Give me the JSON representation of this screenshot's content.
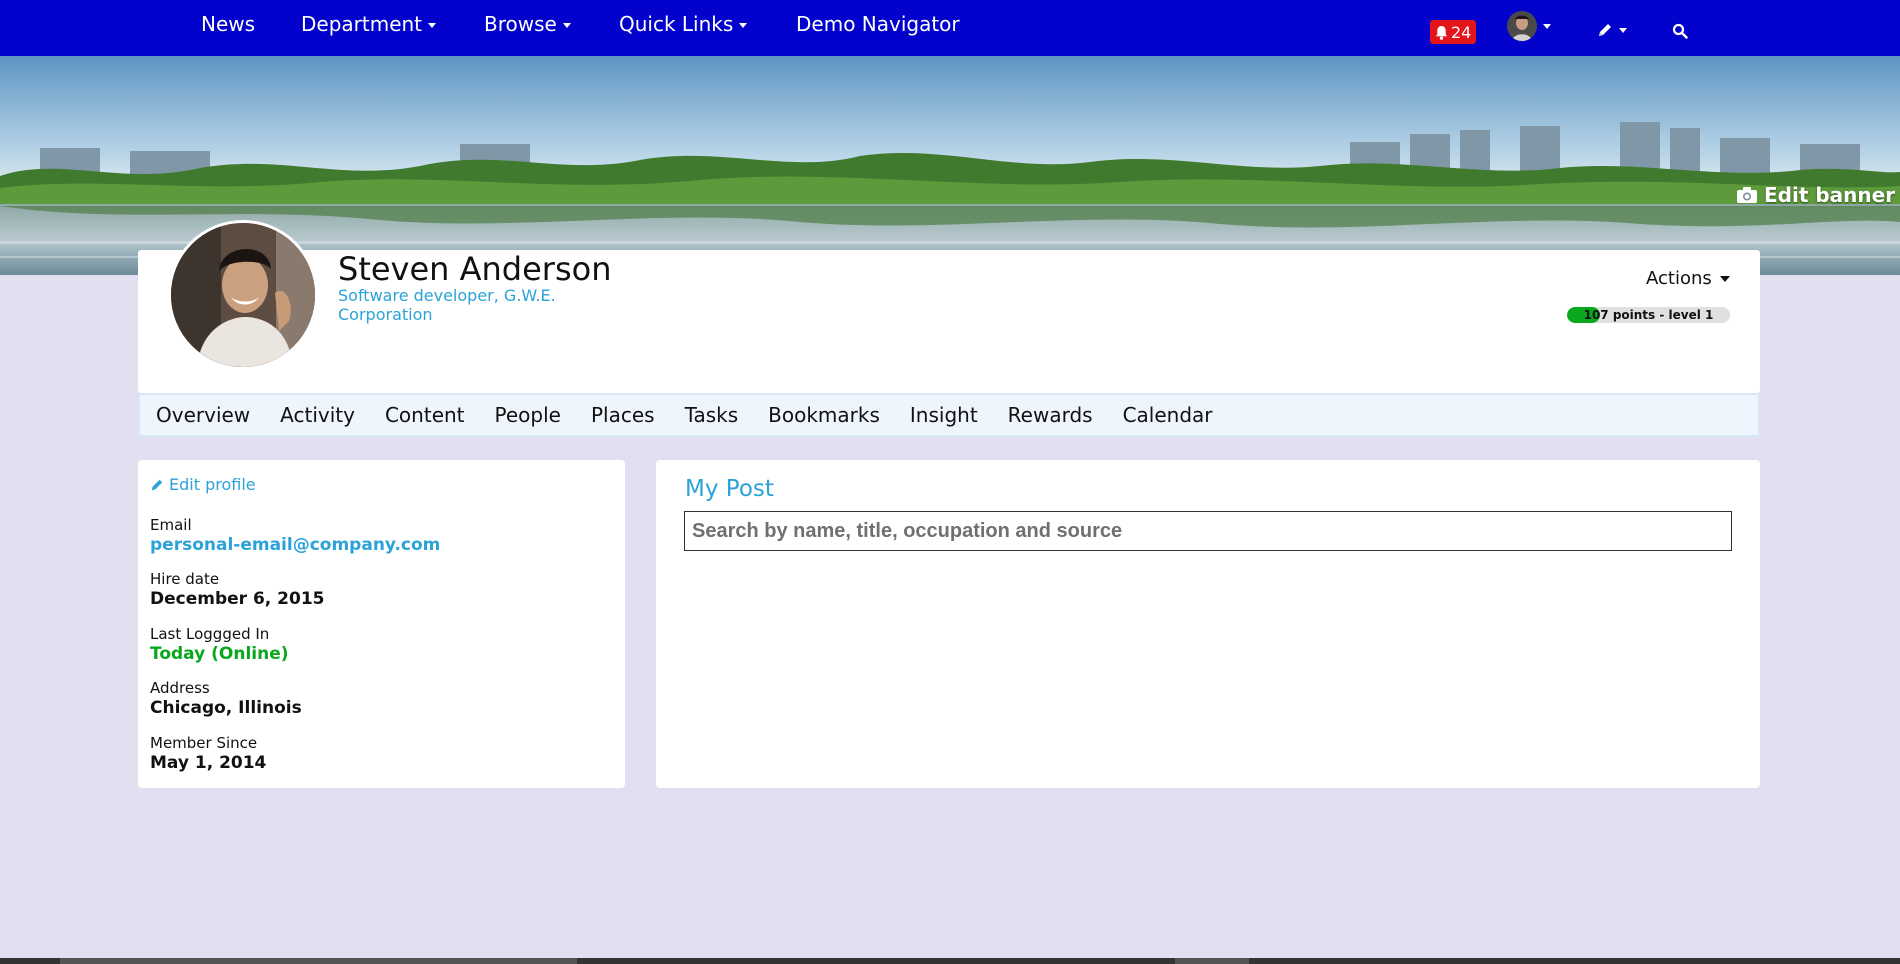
{
  "nav": {
    "items": [
      {
        "label": "News",
        "dropdown": false
      },
      {
        "label": "Department",
        "dropdown": true
      },
      {
        "label": "Browse",
        "dropdown": true
      },
      {
        "label": "Quick Links",
        "dropdown": true
      },
      {
        "label": "Demo Navigator",
        "dropdown": false
      }
    ],
    "notifications_count": "24",
    "icons": {
      "notifications": "bell-icon",
      "user": "avatar",
      "compose": "pencil-icon",
      "search": "search-icon"
    }
  },
  "banner": {
    "edit_label": "Edit banner",
    "edit_icon": "camera-icon"
  },
  "profile": {
    "name": "Steven Anderson",
    "title": "Software developer, G.W.E. Corporation",
    "actions_label": "Actions",
    "points_label": "107 points - level 1",
    "level_progress": 0.2
  },
  "tabs": [
    "Overview",
    "Activity",
    "Content",
    "People",
    "Places",
    "Tasks",
    "Bookmarks",
    "Insight",
    "Rewards",
    "Calendar"
  ],
  "info": {
    "edit_label": "Edit profile",
    "fields": [
      {
        "label": "Email",
        "value": "personal-email@company.com"
      },
      {
        "label": "Hire date",
        "value": "December 6, 2015"
      },
      {
        "label": "Last Loggged In",
        "value": "Today (Online)"
      },
      {
        "label": "Address",
        "value": "Chicago, Illinois"
      },
      {
        "label": "Member Since",
        "value": "May 1, 2014"
      }
    ]
  },
  "post": {
    "title": "My Post",
    "search_placeholder": "Search by name, title, occupation and source"
  },
  "colors": {
    "nav_bg": "#0202cc",
    "accent": "#2ba3d8",
    "online": "#0aa81e",
    "badge": "#e3141b",
    "page_bg": "#e2dff1"
  }
}
